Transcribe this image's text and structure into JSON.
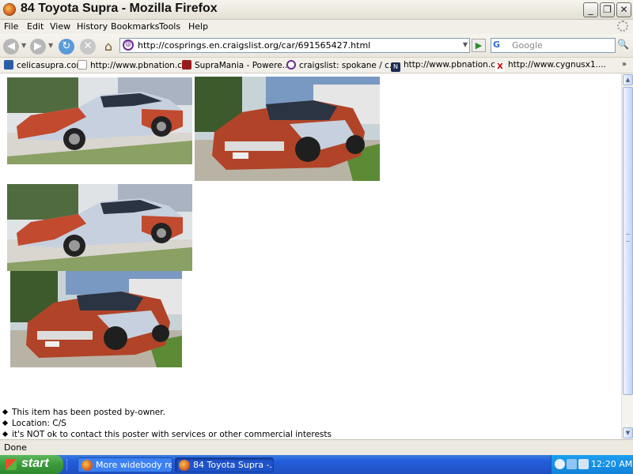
{
  "window": {
    "title": "84 Toyota Supra - Mozilla Firefox",
    "controls": {
      "minimize": "_",
      "maximize": "❐",
      "close": "✕"
    }
  },
  "menu": [
    "File",
    "Edit",
    "View",
    "History",
    "Bookmarks",
    "Tools",
    "Help"
  ],
  "toolbar": {
    "url": "http://cosprings.en.craigslist.org/car/691565427.html",
    "search_placeholder": "Google",
    "search_engine_icon": "G"
  },
  "bookmarks": [
    "celicasupra.com",
    "http://www.pbnation.c...",
    "SupraMania - Powere...",
    "craigslist: spokane / c...",
    "http://www.pbnation.c...",
    "http://www.cygnusx1...."
  ],
  "bookmarks_more": "»",
  "content": {
    "photos": [
      {
        "alt": "car-photo-side-view-1"
      },
      {
        "alt": "car-photo-front-view-1"
      },
      {
        "alt": "car-photo-side-view-2"
      },
      {
        "alt": "car-photo-front-view-2"
      }
    ],
    "bullets": [
      "This item has been posted by-owner.",
      "Location: C/S",
      "it's NOT ok to contact this poster with services or other commercial interests"
    ]
  },
  "status": "Done",
  "taskbar": {
    "start": "start",
    "items": [
      "More widebody re...",
      "84 Toyota Supra -..."
    ],
    "clock": "12:20 AM"
  }
}
